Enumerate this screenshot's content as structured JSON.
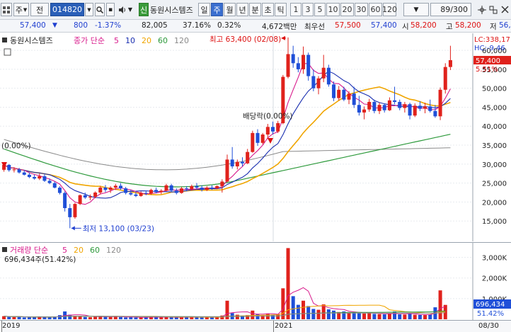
{
  "toolbar": {
    "market_label": "주",
    "market_btn": "전",
    "code": "014820",
    "new_badge": "신",
    "stock_name": "동원시스템즈",
    "periods": [
      "일",
      "주",
      "월",
      "년",
      "분",
      "초",
      "틱"
    ],
    "active_period": "주",
    "intervals": [
      "1",
      "3",
      "5",
      "10",
      "20",
      "30",
      "60",
      "120"
    ],
    "count": "89/300"
  },
  "quote": {
    "price": "57,400",
    "change_arrow": "▼",
    "change": "800",
    "change_pct": "-1.37%",
    "volume": "82,005",
    "vol_ratio": "37.16%",
    "turnover": "0.32%",
    "amount": "4,672백만",
    "best_ask_label": "최우선",
    "best_ask": "57,500",
    "best_bid": "57,400",
    "open_label": "시",
    "open": "58,200",
    "high_label": "고",
    "high": "58,200",
    "low_label": "저",
    "low": "56,"
  },
  "price_pane": {
    "legend_name": "동원시스템즈",
    "legend_ma_label": "종가 단순",
    "legend_ma": [
      "5",
      "10",
      "20",
      "60",
      "120"
    ],
    "lc_label": "LC:338,17",
    "hc_label": "HC:-9.46",
    "current_price_tag": "57,400",
    "current_pct": "5.51%",
    "y_ticks": [
      "60,000",
      "55,000",
      "50,000",
      "45,000",
      "40,000",
      "35,000",
      "30,000",
      "25,000",
      "20,000",
      "15,000"
    ],
    "annotation_high": "최고 63,400 (02/08)",
    "annotation_low": "최저 13,100 (03/23)",
    "annotation_dividend": "배당락(0.00%)",
    "annotation_start": "(0.00%)"
  },
  "volume_pane": {
    "legend": "거래량 단순",
    "legend_ma": [
      "5",
      "20",
      "60",
      "120"
    ],
    "current_value": "696,434주(51.42%)",
    "y_ticks": [
      "3,000K",
      "2,000K",
      "1,000K"
    ],
    "tag_value": "696,434",
    "tag_pct": "51.42%"
  },
  "x_axis": {
    "labels": [
      "2019",
      "2021"
    ],
    "right_label": "08/30"
  },
  "colors": {
    "up": "#e0221c",
    "down": "#1f4fd8",
    "ma5": "#d81b8c",
    "ma10": "#1a2fb0",
    "ma20": "#f0a500",
    "ma60": "#2e9a3c",
    "ma120": "#8a8a8a"
  },
  "chart_data": {
    "type": "candlestick",
    "price_axis": [
      10000,
      63000
    ],
    "candles": [
      [
        28500,
        30500,
        28000,
        29800
      ],
      [
        29800,
        30000,
        28000,
        28400
      ],
      [
        28400,
        29200,
        27800,
        28600
      ],
      [
        28600,
        29000,
        27500,
        27800
      ],
      [
        27800,
        28500,
        27000,
        27200
      ],
      [
        27200,
        27800,
        26300,
        26600
      ],
      [
        26600,
        27200,
        25900,
        26200
      ],
      [
        26200,
        27500,
        25800,
        26800
      ],
      [
        26800,
        27300,
        25300,
        25600
      ],
      [
        25600,
        26200,
        24700,
        25000
      ],
      [
        25000,
        25400,
        23600,
        23800
      ],
      [
        23800,
        24200,
        22000,
        22400
      ],
      [
        22400,
        22800,
        17500,
        18400
      ],
      [
        18400,
        19500,
        13100,
        16000
      ],
      [
        16000,
        19800,
        15600,
        19500
      ],
      [
        19500,
        22000,
        19200,
        21800
      ],
      [
        21800,
        22500,
        20800,
        21200
      ],
      [
        21200,
        22000,
        20500,
        21400
      ],
      [
        21400,
        22800,
        21000,
        22500
      ],
      [
        22500,
        24200,
        22000,
        23800
      ],
      [
        23800,
        24500,
        22600,
        23200
      ],
      [
        23200,
        24200,
        22400,
        23800
      ],
      [
        23800,
        24800,
        23200,
        24300
      ],
      [
        24300,
        25000,
        23200,
        23600
      ],
      [
        23600,
        24000,
        22000,
        22400
      ],
      [
        22400,
        23200,
        21700,
        22000
      ],
      [
        22000,
        22800,
        21300,
        21600
      ],
      [
        21600,
        22800,
        21400,
        22400
      ],
      [
        22400,
        23000,
        21800,
        22200
      ],
      [
        22200,
        23500,
        21900,
        23200
      ],
      [
        23200,
        23800,
        22300,
        22600
      ],
      [
        22600,
        23400,
        22100,
        23000
      ],
      [
        23000,
        24800,
        22800,
        24400
      ],
      [
        24400,
        24800,
        22600,
        23000
      ],
      [
        23000,
        23600,
        22000,
        22400
      ],
      [
        22400,
        24000,
        22200,
        23600
      ],
      [
        23600,
        24200,
        22800,
        23400
      ],
      [
        23400,
        24600,
        23000,
        24200
      ],
      [
        24200,
        25000,
        23400,
        23800
      ],
      [
        23800,
        24400,
        22800,
        23200
      ],
      [
        23200,
        24200,
        22900,
        23800
      ],
      [
        23800,
        24400,
        23200,
        23600
      ],
      [
        23600,
        24400,
        23400,
        24200
      ],
      [
        24200,
        26000,
        22500,
        25400
      ],
      [
        25400,
        32500,
        25200,
        31200
      ],
      [
        31200,
        34500,
        28800,
        29400
      ],
      [
        29400,
        31200,
        28600,
        30600
      ],
      [
        30600,
        31800,
        29400,
        30200
      ],
      [
        30200,
        34000,
        30000,
        33200
      ],
      [
        33200,
        38800,
        33000,
        38200
      ],
      [
        38200,
        39200,
        34800,
        35600
      ],
      [
        35600,
        38200,
        35200,
        37800
      ],
      [
        37800,
        40600,
        36600,
        39800
      ],
      [
        39800,
        41200,
        37800,
        38600
      ],
      [
        38600,
        41400,
        38200,
        40800
      ],
      [
        40800,
        53500,
        40500,
        53000
      ],
      [
        53000,
        63400,
        52600,
        59000
      ],
      [
        59000,
        61200,
        55400,
        56600
      ],
      [
        56600,
        58200,
        54200,
        55000
      ],
      [
        55000,
        61000,
        53800,
        58800
      ],
      [
        58800,
        59400,
        52000,
        53200
      ],
      [
        53200,
        55000,
        49200,
        50000
      ],
      [
        50000,
        53200,
        48400,
        52600
      ],
      [
        52600,
        58800,
        51600,
        55400
      ],
      [
        55400,
        56200,
        50400,
        51000
      ],
      [
        51000,
        51800,
        46600,
        47400
      ],
      [
        47400,
        50600,
        46800,
        49600
      ],
      [
        49600,
        50400,
        46600,
        47000
      ],
      [
        47000,
        49200,
        45800,
        48600
      ],
      [
        48600,
        50400,
        44800,
        45600
      ],
      [
        45600,
        48000,
        42800,
        43600
      ],
      [
        43600,
        45200,
        41800,
        44400
      ],
      [
        44400,
        47200,
        43800,
        46400
      ],
      [
        46400,
        47000,
        43400,
        44000
      ],
      [
        44000,
        46200,
        43200,
        45600
      ],
      [
        45600,
        46000,
        43600,
        44200
      ],
      [
        44200,
        47600,
        44000,
        46800
      ],
      [
        46800,
        50400,
        45800,
        46400
      ],
      [
        46400,
        47000,
        44200,
        44800
      ],
      [
        44800,
        46400,
        43600,
        45800
      ],
      [
        45800,
        46200,
        41800,
        42800
      ],
      [
        42800,
        46000,
        42400,
        45400
      ],
      [
        45400,
        46600,
        44000,
        44600
      ],
      [
        44600,
        46200,
        43400,
        45200
      ],
      [
        45200,
        47000,
        43600,
        44000
      ],
      [
        44000,
        45600,
        42200,
        42600
      ],
      [
        42600,
        50200,
        41600,
        49600
      ],
      [
        49600,
        56600,
        48600,
        55600
      ],
      [
        55600,
        61200,
        54800,
        57400
      ]
    ],
    "volumes": [
      150,
      120,
      110,
      130,
      90,
      95,
      100,
      140,
      110,
      90,
      130,
      200,
      380,
      220,
      160,
      140,
      110,
      100,
      130,
      160,
      120,
      110,
      140,
      110,
      90,
      100,
      85,
      95,
      110,
      130,
      90,
      85,
      120,
      100,
      90,
      110,
      100,
      120,
      95,
      90,
      100,
      95,
      110,
      180,
      900,
      300,
      220,
      180,
      200,
      420,
      240,
      200,
      280,
      220,
      260,
      1500,
      3450,
      1120,
      700,
      900,
      640,
      500,
      460,
      720,
      480,
      420,
      350,
      380,
      330,
      320,
      300,
      280,
      320,
      260,
      250,
      240,
      260,
      380,
      240,
      230,
      260,
      220,
      210,
      200,
      240,
      580,
      1400,
      696
    ],
    "volume_axis": [
      0,
      3500
    ]
  }
}
